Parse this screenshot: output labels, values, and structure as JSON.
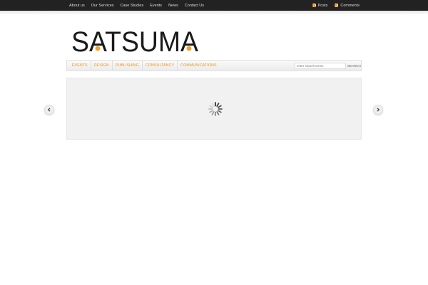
{
  "topnav": {
    "items": [
      "About us",
      "Our Services",
      "Case Studies",
      "Events",
      "News",
      "Contact Us"
    ]
  },
  "feeds": {
    "posts": "Posts",
    "comments": "Comments"
  },
  "logo": {
    "text": "SATSUMA",
    "dot_color": "#f0a030"
  },
  "categories": [
    "EVENTS",
    "DESIGN",
    "PUBLISHING",
    "CONSULTANCY",
    "COMMUNICATIONS"
  ],
  "search": {
    "placeholder": "enter search terms",
    "button": "SEARCH"
  },
  "icons": {
    "prev": "chevron-left-icon",
    "next": "chevron-right-icon",
    "loader": "loading-spinner-icon",
    "feed": "rss-icon"
  },
  "colors": {
    "accent": "#e8941c",
    "topbar": "#222222"
  }
}
